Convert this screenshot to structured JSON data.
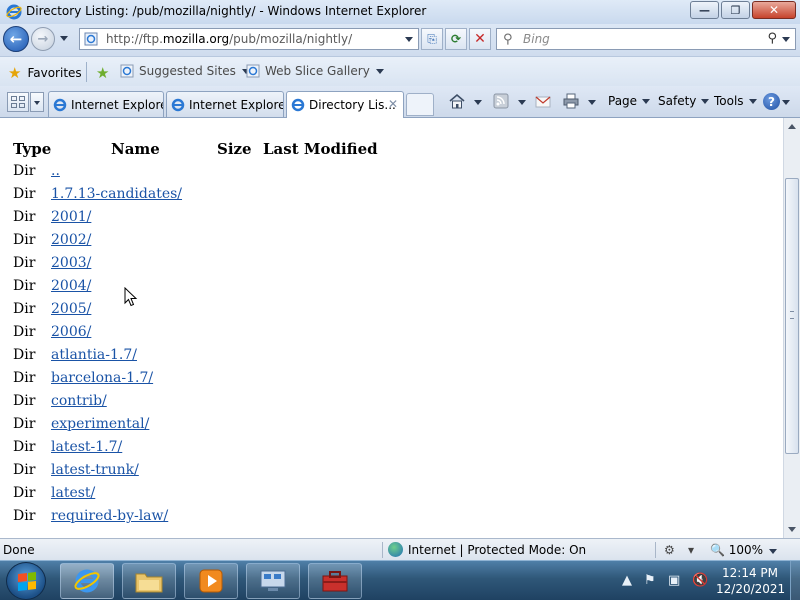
{
  "window": {
    "title": "Directory Listing: /pub/mozilla/nightly/ - Windows Internet Explorer",
    "minimize_glyph": "—",
    "maximize_glyph": "❐",
    "close_glyph": "✕"
  },
  "navigation": {
    "back_glyph": "←",
    "forward_glyph": "→",
    "url_prefix": "http://ftp.",
    "url_host": "mozilla.org",
    "url_path": "/pub/mozilla/nightly/",
    "compat_glyph": "⎘",
    "refresh_glyph": "⟳",
    "stop_glyph": "✕",
    "search_placeholder": "Bing",
    "search_icon_glyph": "⚲",
    "search_go_glyph": "⚲"
  },
  "favorites_bar": {
    "favorites_label": "Favorites",
    "items": [
      {
        "label": "Suggested Sites"
      },
      {
        "label": "Web Slice Gallery"
      }
    ]
  },
  "tabs": [
    {
      "label": "Internet Explore...",
      "active": false
    },
    {
      "label": "Internet Explore...",
      "active": false
    },
    {
      "label": "Directory Lis...",
      "active": true
    }
  ],
  "tab_close_glyph": "✕",
  "command_bar": {
    "page_label": "Page",
    "safety_label": "Safety",
    "tools_label": "Tools",
    "help_glyph": "?"
  },
  "listing": {
    "headers": {
      "type": "Type",
      "name": "Name",
      "size": "Size",
      "last_modified": "Last Modified"
    },
    "rows": [
      {
        "type": "Dir",
        "name": ".."
      },
      {
        "type": "Dir",
        "name": "1.7.13-candidates/"
      },
      {
        "type": "Dir",
        "name": "2001/"
      },
      {
        "type": "Dir",
        "name": "2002/"
      },
      {
        "type": "Dir",
        "name": "2003/"
      },
      {
        "type": "Dir",
        "name": "2004/"
      },
      {
        "type": "Dir",
        "name": "2005/"
      },
      {
        "type": "Dir",
        "name": "2006/"
      },
      {
        "type": "Dir",
        "name": "atlantia-1.7/"
      },
      {
        "type": "Dir",
        "name": "barcelona-1.7/"
      },
      {
        "type": "Dir",
        "name": "contrib/"
      },
      {
        "type": "Dir",
        "name": "experimental/"
      },
      {
        "type": "Dir",
        "name": "latest-1.7/"
      },
      {
        "type": "Dir",
        "name": "latest-trunk/"
      },
      {
        "type": "Dir",
        "name": "latest/"
      },
      {
        "type": "Dir",
        "name": "required-by-law/"
      }
    ]
  },
  "status_bar": {
    "status_text": "Done",
    "zone_text": "Internet | Protected Mode: On",
    "zoom_text": "🔍 100%"
  },
  "taskbar": {
    "time": "12:14 PM",
    "date": "12/20/2021"
  },
  "colors": {
    "link": "#1a53a6",
    "chrome": "#dbe6f4",
    "taskbar": "#2f5778"
  }
}
